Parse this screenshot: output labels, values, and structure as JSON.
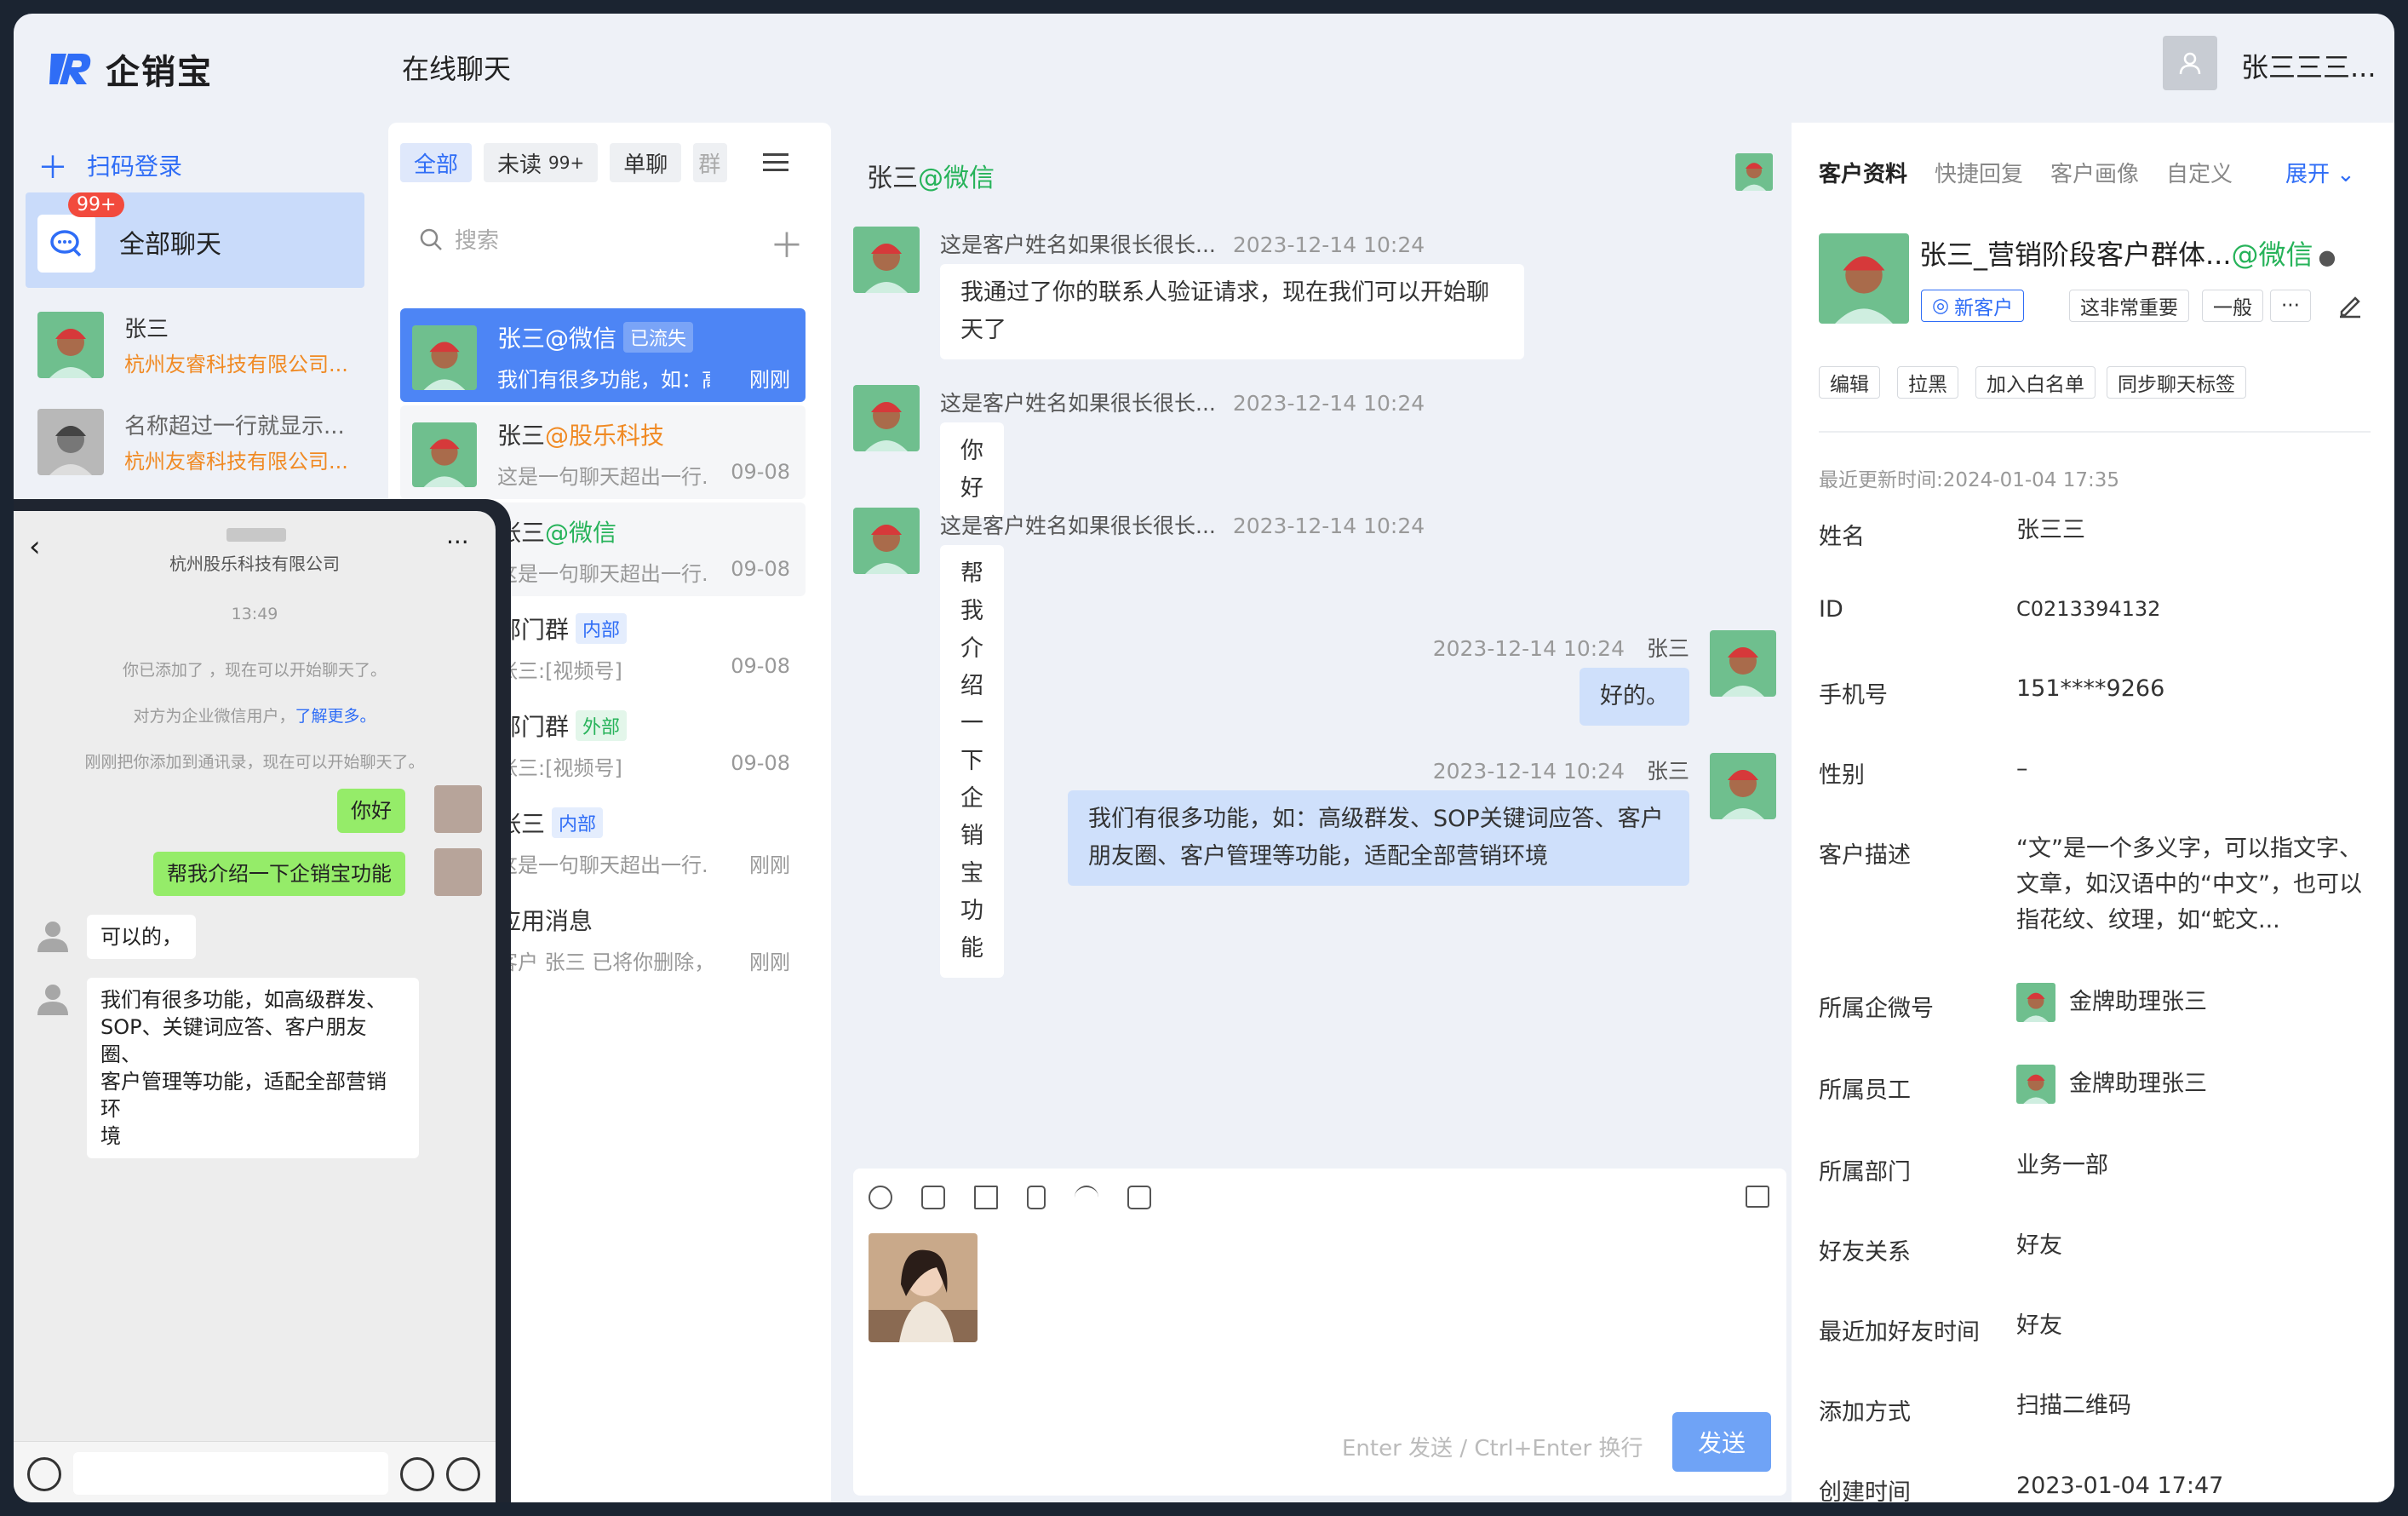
{
  "app": {
    "logo_text": "企销宝",
    "page_title": "在线聊天",
    "user_name": "张三三三..."
  },
  "sidebar": {
    "scan_login": "扫码登录",
    "all_chat": {
      "label": "全部聊天",
      "badge": "99+"
    },
    "contacts": [
      {
        "name": "张三",
        "company": "杭州友睿科技有限公司..."
      },
      {
        "name": "名称超过一行就显示...",
        "company": "杭州友睿科技有限公司..."
      }
    ]
  },
  "conversation_list": {
    "tabs": [
      "全部",
      "未读",
      "单聊",
      "群"
    ],
    "unread_badge": "99+",
    "search_placeholder": "搜索",
    "items": [
      {
        "name": "张三",
        "source": "@微信",
        "tag": "已流失",
        "message": "我们有很多功能，如：高...",
        "time": "刚刚"
      },
      {
        "name": "张三",
        "source": "@股乐科技",
        "tag": "",
        "message": "这是一句聊天超出一行...",
        "time": "09-08"
      },
      {
        "name": "张三",
        "source": "@微信",
        "tag": "",
        "message": "这是一句聊天超出一行...",
        "time": "09-08"
      },
      {
        "name": "部门群",
        "source": "",
        "tag": "内部",
        "message": "张三:[视频号]",
        "time": "09-08"
      },
      {
        "name": "部门群",
        "source": "",
        "tag": "外部",
        "message": "张三:[视频号]",
        "time": "09-08"
      },
      {
        "name": "张三",
        "source": "",
        "tag": "内部",
        "message": "这是一句聊天超出一行...",
        "time": "刚刚"
      },
      {
        "name": "应用消息",
        "source": "",
        "tag": "",
        "message": "客户 张三 已将你删除，...",
        "time": "刚刚"
      }
    ]
  },
  "chat": {
    "header_name": "张三",
    "header_source": "@微信",
    "messages": [
      {
        "side": "left",
        "sender": "这是客户姓名如果很长很长...",
        "time": "2023-12-14 10:24",
        "lines": [
          "我通过了你的联系人验证请求，现在我们可以开始聊",
          "天了"
        ]
      },
      {
        "side": "left",
        "sender": "这是客户姓名如果很长很长...",
        "time": "2023-12-14 10:24",
        "lines": [
          "你好"
        ]
      },
      {
        "side": "left",
        "sender": "这是客户姓名如果很长很长...",
        "time": "2023-12-14 10:24",
        "lines": [
          "帮我介绍一下企销宝功能"
        ]
      },
      {
        "side": "right",
        "sender": "张三",
        "time": "2023-12-14 10:24",
        "lines": [
          "好的。"
        ]
      },
      {
        "side": "right",
        "sender": "张三",
        "time": "2023-12-14 10:24",
        "lines": [
          "我们有很多功能，如：高级群发、SOP关键词应答、客户",
          "朋友圈、客户管理等功能，适配全部营销环境"
        ]
      }
    ],
    "composer": {
      "hint": "Enter 发送 / Ctrl+Enter 换行",
      "send_label": "发送"
    }
  },
  "customer_panel": {
    "tabs": [
      "客户资料",
      "快捷回复",
      "客户画像",
      "自定义"
    ],
    "expand_label": "展开",
    "title": "张三_营销阶段客户群体...",
    "title_source": "@微信",
    "tags": [
      "新客户",
      "这非常重要",
      "一般",
      "···"
    ],
    "actions": [
      "编辑",
      "拉黑",
      "加入白名单",
      "同步聊天标签"
    ],
    "updated": "最近更新时间:2024-01-04 17:35",
    "fields": [
      {
        "label": "姓名",
        "value": "张三三"
      },
      {
        "label": "ID",
        "value": "C0213394132"
      },
      {
        "label": "手机号",
        "value": "151****9266"
      },
      {
        "label": "性别",
        "value": "–"
      },
      {
        "label": "客户描述",
        "value": "“文”是一个多义字，可以指文字、文章，如汉语中的“中文”，也可以指花纹、纹理，如“蛇文..."
      },
      {
        "label": "所属企微号",
        "value": "金牌助理张三"
      },
      {
        "label": "所属员工",
        "value": "金牌助理张三"
      },
      {
        "label": "所属部门",
        "value": "业务一部"
      },
      {
        "label": "好友关系",
        "value": "好友"
      },
      {
        "label": "最近加好友时间",
        "value": "好友"
      },
      {
        "label": "添加方式",
        "value": "扫描二维码"
      },
      {
        "label": "创建时间",
        "value": "2023-01-04 17:47"
      }
    ]
  },
  "phone": {
    "company": "杭州股乐科技有限公司",
    "time": "13:49",
    "system_1": "你已添加了      ，现在可以开始聊天了。",
    "system_2": "对方为企业微信用户，",
    "system_2_link": "了解更多。",
    "system_3": "       刚刚把你添加到通讯录，现在可以开始聊天了。",
    "msg_1": "你好",
    "msg_2": "帮我介绍一下企销宝功能",
    "msg_3": "可以的，",
    "msg_4": [
      "我们有很多功能，如高级群发、",
      "SOP、关键词应答、客户朋友圈、",
      "客户管理等功能，适配全部营销环",
      "境"
    ]
  }
}
